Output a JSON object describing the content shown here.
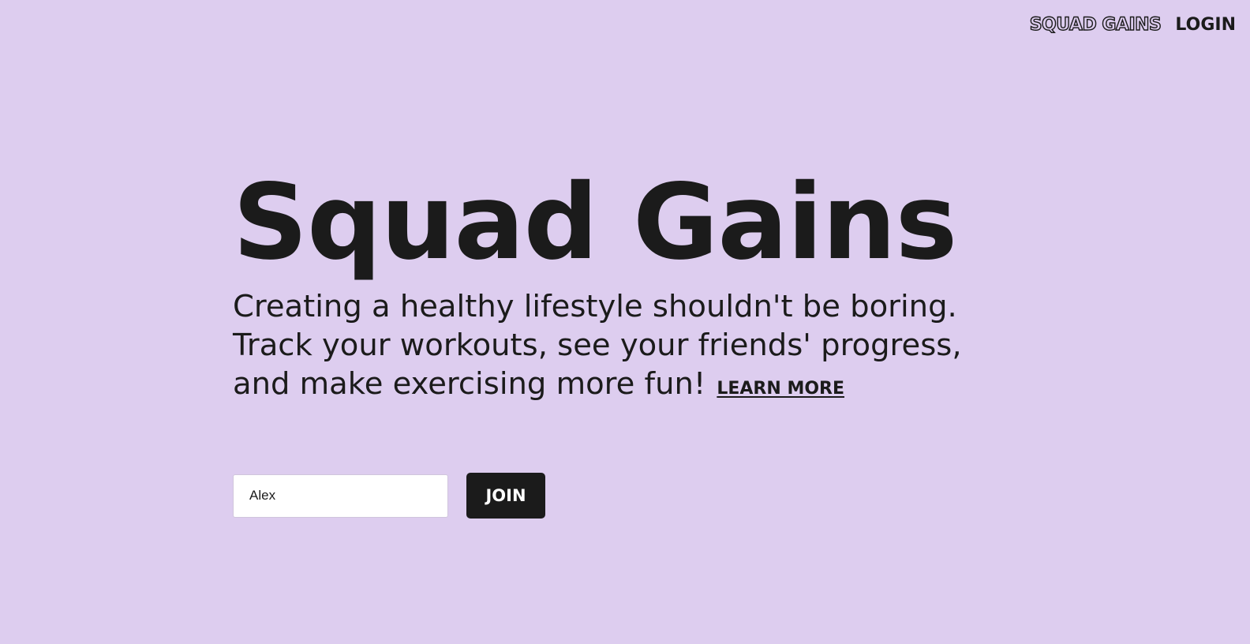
{
  "colors": {
    "background": "#ddcdef",
    "text": "#1b1b1b",
    "button_bg": "#1b1b1b",
    "button_text": "#ffffff",
    "input_bg": "#ffffff"
  },
  "nav": {
    "brand": "SQUAD GAINS",
    "login": "LOGIN"
  },
  "hero": {
    "title": "Squad Gains",
    "description_lines": [
      "Creating a healthy lifestyle shouldn't be boring.",
      "Track your workouts, see your friends' progress,",
      "and make exercising more fun!"
    ],
    "learn_more": "LEARN MORE"
  },
  "join_form": {
    "name_value": "Alex",
    "join_label": "JOIN"
  }
}
